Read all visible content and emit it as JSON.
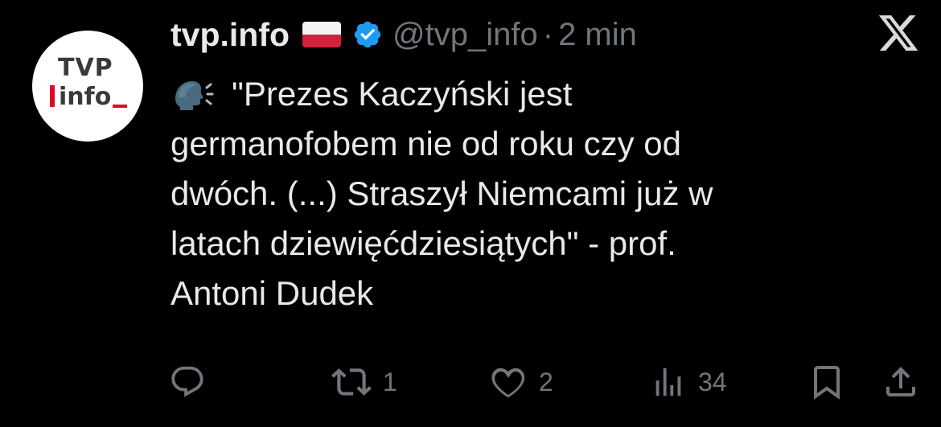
{
  "avatar": {
    "line1": "TVP",
    "line2": "info"
  },
  "header": {
    "display_name": "tvp.info",
    "flag_icon": "poland-flag-icon",
    "verified_icon": "verified-badge-icon",
    "handle": "@tvp_info",
    "separator": "·",
    "time": "2 min",
    "close_icon": "x-logo-icon"
  },
  "tweet": {
    "emoji_icon": "speaking-head-icon",
    "lines": [
      "\"Prezes Kaczyński jest",
      "germanofobem nie od roku czy od",
      "dwóch. (...) Straszył Niemcami już w",
      "latach dziewięćdziesiątych\" - prof.",
      "Antoni Dudek"
    ]
  },
  "actions": {
    "reply": {
      "icon": "reply-icon"
    },
    "retweet": {
      "icon": "retweet-icon",
      "count": "1"
    },
    "like": {
      "icon": "heart-icon",
      "count": "2"
    },
    "views": {
      "icon": "views-icon",
      "count": "34"
    },
    "bookmark": {
      "icon": "bookmark-icon"
    },
    "share": {
      "icon": "share-icon"
    }
  },
  "colors": {
    "background": "#000000",
    "text": "#e7e9ea",
    "muted": "#71767b",
    "verified": "#1d9bf0",
    "brand_red": "#e4002b"
  }
}
